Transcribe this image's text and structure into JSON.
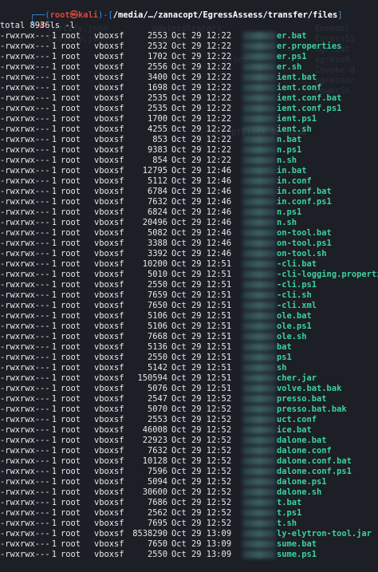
{
  "prompt": {
    "user_host": "root㉿kali",
    "path": "/media/…/zanacopt/EgressAssess/transfer/files",
    "symbol": "#",
    "command": "ls -l"
  },
  "total_line": "total 8936",
  "colors": {
    "background": "#1c1f26",
    "bracket": "#3c8cdc",
    "user": "#e0443c",
    "filename": "#3bd39e",
    "text": "#e8e8e8"
  },
  "files": [
    {
      "perm": "-rwxrwx---",
      "links": "1",
      "owner": "root",
      "group": "vboxsf",
      "size": "2553",
      "date": "Oct 29 12:22",
      "name": "er.bat"
    },
    {
      "perm": "-rwxrwx---",
      "links": "1",
      "owner": "root",
      "group": "vboxsf",
      "size": "2532",
      "date": "Oct 29 12:22",
      "name": "er.properties"
    },
    {
      "perm": "-rwxrwx---",
      "links": "1",
      "owner": "root",
      "group": "vboxsf",
      "size": "1702",
      "date": "Oct 29 12:22",
      "name": "er.ps1"
    },
    {
      "perm": "-rwxrwx---",
      "links": "1",
      "owner": "root",
      "group": "vboxsf",
      "size": "2556",
      "date": "Oct 29 12:22",
      "name": "er.sh"
    },
    {
      "perm": "-rwxrwx---",
      "links": "1",
      "owner": "root",
      "group": "vboxsf",
      "size": "3400",
      "date": "Oct 29 12:22",
      "name": "ient.bat"
    },
    {
      "perm": "-rwxrwx---",
      "links": "1",
      "owner": "root",
      "group": "vboxsf",
      "size": "1698",
      "date": "Oct 29 12:22",
      "name": "ient.conf"
    },
    {
      "perm": "-rwxrwx---",
      "links": "1",
      "owner": "root",
      "group": "vboxsf",
      "size": "2535",
      "date": "Oct 29 12:22",
      "name": "ient.conf.bat"
    },
    {
      "perm": "-rwxrwx---",
      "links": "1",
      "owner": "root",
      "group": "vboxsf",
      "size": "2535",
      "date": "Oct 29 12:22",
      "name": "ient.conf.ps1"
    },
    {
      "perm": "-rwxrwx---",
      "links": "1",
      "owner": "root",
      "group": "vboxsf",
      "size": "1700",
      "date": "Oct 29 12:22",
      "name": "ient.ps1"
    },
    {
      "perm": "-rwxrwx---",
      "links": "1",
      "owner": "root",
      "group": "vboxsf",
      "size": "4255",
      "date": "Oct 29 12:22",
      "name": "ient.sh"
    },
    {
      "perm": "-rwxrwx---",
      "links": "1",
      "owner": "root",
      "group": "vboxsf",
      "size": "853",
      "date": "Oct 29 12:22",
      "name": "n.bat"
    },
    {
      "perm": "-rwxrwx---",
      "links": "1",
      "owner": "root",
      "group": "vboxsf",
      "size": "9383",
      "date": "Oct 29 12:22",
      "name": "n.ps1"
    },
    {
      "perm": "-rwxrwx---",
      "links": "1",
      "owner": "root",
      "group": "vboxsf",
      "size": "854",
      "date": "Oct 29 12:22",
      "name": "n.sh"
    },
    {
      "perm": "-rwxrwx---",
      "links": "1",
      "owner": "root",
      "group": "vboxsf",
      "size": "12795",
      "date": "Oct 29 12:46",
      "name": "in.bat"
    },
    {
      "perm": "-rwxrwx---",
      "links": "1",
      "owner": "root",
      "group": "vboxsf",
      "size": "5112",
      "date": "Oct 29 12:46",
      "name": "in.conf"
    },
    {
      "perm": "-rwxrwx---",
      "links": "1",
      "owner": "root",
      "group": "vboxsf",
      "size": "6784",
      "date": "Oct 29 12:46",
      "name": "in.conf.bat"
    },
    {
      "perm": "-rwxrwx---",
      "links": "1",
      "owner": "root",
      "group": "vboxsf",
      "size": "7632",
      "date": "Oct 29 12:46",
      "name": "in.conf.ps1"
    },
    {
      "perm": "-rwxrwx---",
      "links": "1",
      "owner": "root",
      "group": "vboxsf",
      "size": "6824",
      "date": "Oct 29 12:46",
      "name": "n.ps1"
    },
    {
      "perm": "-rwxrwx---",
      "links": "1",
      "owner": "root",
      "group": "vboxsf",
      "size": "20496",
      "date": "Oct 29 12:46",
      "name": "n.sh"
    },
    {
      "perm": "-rwxrwx---",
      "links": "1",
      "owner": "root",
      "group": "vboxsf",
      "size": "5082",
      "date": "Oct 29 12:46",
      "name": "on-tool.bat"
    },
    {
      "perm": "-rwxrwx---",
      "links": "1",
      "owner": "root",
      "group": "vboxsf",
      "size": "3388",
      "date": "Oct 29 12:46",
      "name": "on-tool.ps1"
    },
    {
      "perm": "-rwxrwx---",
      "links": "1",
      "owner": "root",
      "group": "vboxsf",
      "size": "3392",
      "date": "Oct 29 12:46",
      "name": "on-tool.sh"
    },
    {
      "perm": "-rwxrwx---",
      "links": "1",
      "owner": "root",
      "group": "vboxsf",
      "size": "10200",
      "date": "Oct 29 12:51",
      "name": "-cli.bat"
    },
    {
      "perm": "-rwxrwx---",
      "links": "1",
      "owner": "root",
      "group": "vboxsf",
      "size": "5010",
      "date": "Oct 29 12:51",
      "name": "-cli-logging.properties"
    },
    {
      "perm": "-rwxrwx---",
      "links": "1",
      "owner": "root",
      "group": "vboxsf",
      "size": "2550",
      "date": "Oct 29 12:51",
      "name": "-cli.ps1"
    },
    {
      "perm": "-rwxrwx---",
      "links": "1",
      "owner": "root",
      "group": "vboxsf",
      "size": "7659",
      "date": "Oct 29 12:51",
      "name": "-cli.sh"
    },
    {
      "perm": "-rwxrwx---",
      "links": "1",
      "owner": "root",
      "group": "vboxsf",
      "size": "7650",
      "date": "Oct 29 12:51",
      "name": "-cli.xml"
    },
    {
      "perm": "-rwxrwx---",
      "links": "1",
      "owner": "root",
      "group": "vboxsf",
      "size": "5106",
      "date": "Oct 29 12:51",
      "name": "ole.bat"
    },
    {
      "perm": "-rwxrwx---",
      "links": "1",
      "owner": "root",
      "group": "vboxsf",
      "size": "5106",
      "date": "Oct 29 12:51",
      "name": "ole.ps1"
    },
    {
      "perm": "-rwxrwx---",
      "links": "1",
      "owner": "root",
      "group": "vboxsf",
      "size": "7668",
      "date": "Oct 29 12:51",
      "name": "ole.sh"
    },
    {
      "perm": "-rwxrwx---",
      "links": "1",
      "owner": "root",
      "group": "vboxsf",
      "size": "5136",
      "date": "Oct 29 12:51",
      "name": "bat"
    },
    {
      "perm": "-rwxrwx---",
      "links": "1",
      "owner": "root",
      "group": "vboxsf",
      "size": "2550",
      "date": "Oct 29 12:51",
      "name": "ps1"
    },
    {
      "perm": "-rwxrwx---",
      "links": "1",
      "owner": "root",
      "group": "vboxsf",
      "size": "5142",
      "date": "Oct 29 12:51",
      "name": "sh"
    },
    {
      "perm": "-rwxrwx---",
      "links": "1",
      "owner": "root",
      "group": "vboxsf",
      "size": "150594",
      "date": "Oct 29 12:51",
      "name": "cher.jar"
    },
    {
      "perm": "-rwxrwx---",
      "links": "1",
      "owner": "root",
      "group": "vboxsf",
      "size": "5076",
      "date": "Oct 29 12:51",
      "name": "volve.bat.bak"
    },
    {
      "perm": "-rwxrwx---",
      "links": "1",
      "owner": "root",
      "group": "vboxsf",
      "size": "2547",
      "date": "Oct 29 12:52",
      "name": "presso.bat"
    },
    {
      "perm": "-rwxrwx---",
      "links": "1",
      "owner": "root",
      "group": "vboxsf",
      "size": "5070",
      "date": "Oct 29 12:52",
      "name": "presso.bat.bak"
    },
    {
      "perm": "-rwxrwx---",
      "links": "1",
      "owner": "root",
      "group": "vboxsf",
      "size": "2553",
      "date": "Oct 29 12:52",
      "name": "uct.conf"
    },
    {
      "perm": "-rwxrwx---",
      "links": "1",
      "owner": "root",
      "group": "vboxsf",
      "size": "46008",
      "date": "Oct 29 12:52",
      "name": "ice.bat"
    },
    {
      "perm": "-rwxrwx---",
      "links": "1",
      "owner": "root",
      "group": "vboxsf",
      "size": "22923",
      "date": "Oct 29 12:52",
      "name": "dalone.bat"
    },
    {
      "perm": "-rwxrwx---",
      "links": "1",
      "owner": "root",
      "group": "vboxsf",
      "size": "7632",
      "date": "Oct 29 12:52",
      "name": "dalone.conf"
    },
    {
      "perm": "-rwxrwx---",
      "links": "1",
      "owner": "root",
      "group": "vboxsf",
      "size": "10128",
      "date": "Oct 29 12:52",
      "name": "dalone.conf.bat"
    },
    {
      "perm": "-rwxrwx---",
      "links": "1",
      "owner": "root",
      "group": "vboxsf",
      "size": "7596",
      "date": "Oct 29 12:52",
      "name": "dalone.conf.ps1"
    },
    {
      "perm": "-rwxrwx---",
      "links": "1",
      "owner": "root",
      "group": "vboxsf",
      "size": "5094",
      "date": "Oct 29 12:52",
      "name": "dalone.ps1"
    },
    {
      "perm": "-rwxrwx---",
      "links": "1",
      "owner": "root",
      "group": "vboxsf",
      "size": "30600",
      "date": "Oct 29 12:52",
      "name": "dalone.sh"
    },
    {
      "perm": "-rwxrwx---",
      "links": "1",
      "owner": "root",
      "group": "vboxsf",
      "size": "7686",
      "date": "Oct 29 12:52",
      "name": "t.bat"
    },
    {
      "perm": "-rwxrwx---",
      "links": "1",
      "owner": "root",
      "group": "vboxsf",
      "size": "2562",
      "date": "Oct 29 12:52",
      "name": "t.ps1"
    },
    {
      "perm": "-rwxrwx---",
      "links": "1",
      "owner": "root",
      "group": "vboxsf",
      "size": "7695",
      "date": "Oct 29 12:52",
      "name": "t.sh"
    },
    {
      "perm": "-rwxrwx---",
      "links": "1",
      "owner": "root",
      "group": "vboxsf",
      "size": "8538290",
      "date": "Oct 29 13:09",
      "name": "ly-elytron-tool.jar"
    },
    {
      "perm": "-rwxrwx---",
      "links": "1",
      "owner": "root",
      "group": "vboxsf",
      "size": "7650",
      "date": "Oct 29 13:09",
      "name": "sume.bat"
    },
    {
      "perm": "-rwxrwx---",
      "links": "1",
      "owner": "root",
      "group": "vboxsf",
      "size": "2550",
      "date": "Oct 29 13:09",
      "name": "sume.ps1"
    }
  ]
}
